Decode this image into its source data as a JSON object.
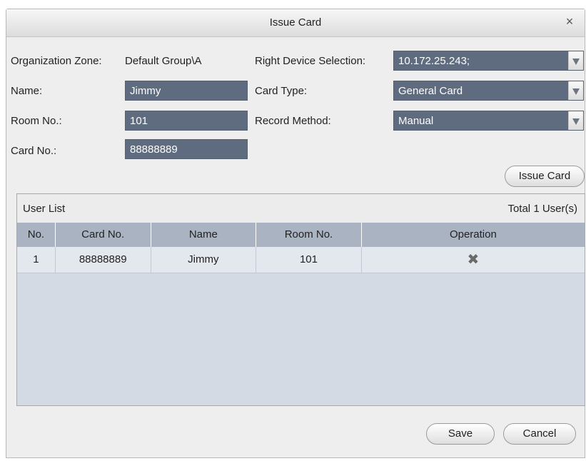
{
  "window": {
    "title": "Issue Card",
    "close_label": "×"
  },
  "form": {
    "organization_zone_label": "Organization Zone:",
    "organization_zone_value": "Default Group\\A",
    "name_label": "Name:",
    "name_value": "Jimmy",
    "room_label": "Room No.:",
    "room_value": "101",
    "card_label": "Card No.:",
    "card_value": "88888889",
    "device_label": "Right Device Selection:",
    "device_value": "10.172.25.243;",
    "card_type_label": "Card Type:",
    "card_type_value": "General Card",
    "record_method_label": "Record Method:",
    "record_method_value": "Manual",
    "issue_button": "Issue Card"
  },
  "user_list": {
    "title": "User List",
    "total_label": "Total",
    "total_count": "1",
    "total_unit": "User(s)",
    "columns": [
      "No.",
      "Card No.",
      "Name",
      "Room No.",
      "Operation"
    ],
    "rows": [
      {
        "no": "1",
        "card": "88888889",
        "name": "Jimmy",
        "room": "101",
        "operation_icon": "delete-x-icon"
      }
    ]
  },
  "footer": {
    "save_label": "Save",
    "cancel_label": "Cancel"
  },
  "colors": {
    "field_bg": "#5f6b7e",
    "grid_header_bg": "#a9b3c2",
    "list_bg": "#d4dae3",
    "dialog_bg": "#eeeeee"
  }
}
